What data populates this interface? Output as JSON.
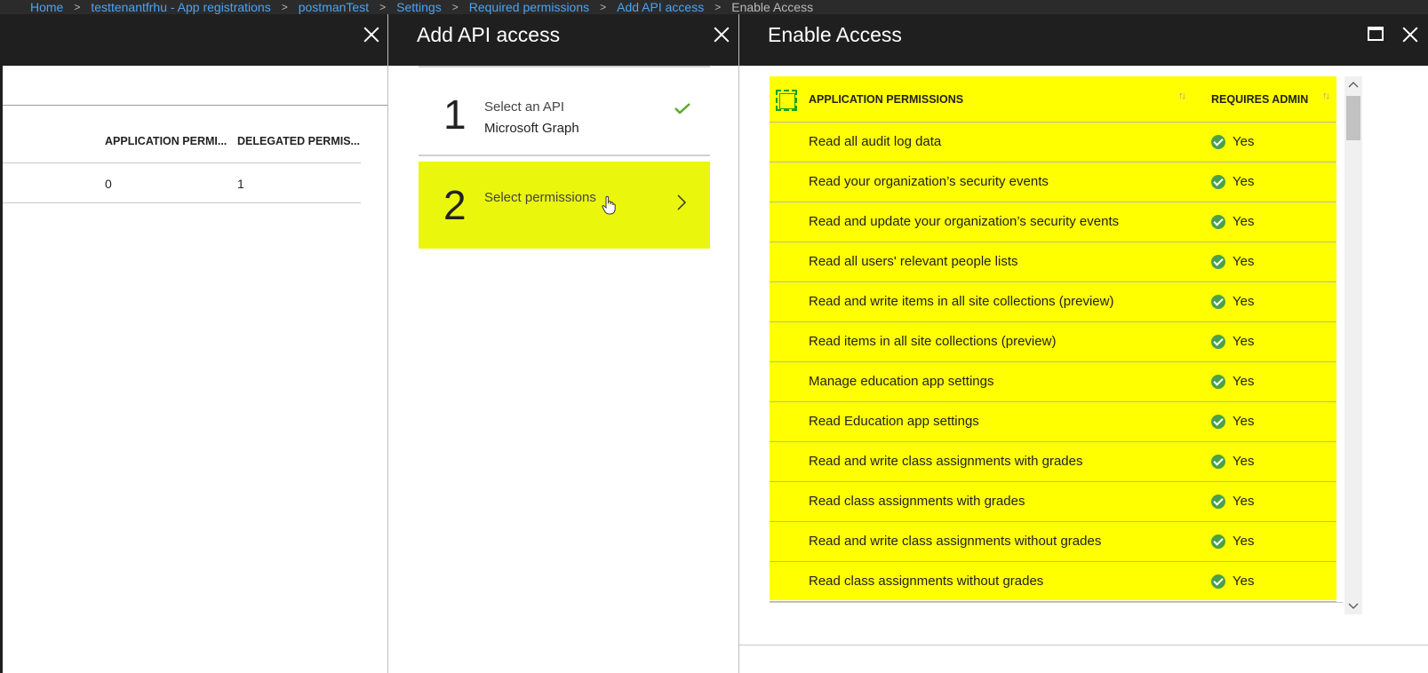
{
  "breadcrumb": [
    {
      "label": "Home"
    },
    {
      "label": "testtenantfrhu - App registrations"
    },
    {
      "label": "postmanTest"
    },
    {
      "label": "Settings"
    },
    {
      "label": "Required permissions"
    },
    {
      "label": "Add API access"
    },
    {
      "label": "Enable Access"
    }
  ],
  "blade1": {
    "columns": {
      "app_perm": "APPLICATION PERMI...",
      "delegated": "DELEGATED PERMIS..."
    },
    "row": {
      "app_perm": "0",
      "delegated": "1"
    }
  },
  "blade2": {
    "title": "Add API access",
    "steps": [
      {
        "number": "1",
        "label": "Select an API",
        "sub": "Microsoft Graph"
      },
      {
        "number": "2",
        "label": "Select permissions",
        "sub": ""
      }
    ]
  },
  "blade3": {
    "title": "Enable Access",
    "columns": {
      "permission": "APPLICATION PERMISSIONS",
      "admin": "REQUIRES ADMIN"
    },
    "permissions": [
      {
        "name": "Read all audit log data",
        "admin": "Yes"
      },
      {
        "name": "Read your organization’s security events",
        "admin": "Yes"
      },
      {
        "name": "Read and update your organization’s security events",
        "admin": "Yes"
      },
      {
        "name": "Read all users' relevant people lists",
        "admin": "Yes"
      },
      {
        "name": "Read and write items in all site collections (preview)",
        "admin": "Yes"
      },
      {
        "name": "Read items in all site collections (preview)",
        "admin": "Yes"
      },
      {
        "name": "Manage education app settings",
        "admin": "Yes"
      },
      {
        "name": "Read Education app settings",
        "admin": "Yes"
      },
      {
        "name": "Read and write class assignments with grades",
        "admin": "Yes"
      },
      {
        "name": "Read class assignments with grades",
        "admin": "Yes"
      },
      {
        "name": "Read and write class assignments without grades",
        "admin": "Yes"
      },
      {
        "name": "Read class assignments without grades",
        "admin": "Yes"
      }
    ]
  },
  "colors": {
    "highlight": "#ffff00",
    "step_highlight": "#eaf70c",
    "header_bg": "#1f1f1f",
    "link": "#4da3f0",
    "check": "#4aa14a"
  },
  "icons": [
    "close-icon",
    "check-icon",
    "chevron-right-icon",
    "hand-cursor-icon",
    "maximize-icon",
    "sort-icon",
    "yes-check-icon",
    "chevron-up-icon",
    "chevron-down-icon"
  ]
}
